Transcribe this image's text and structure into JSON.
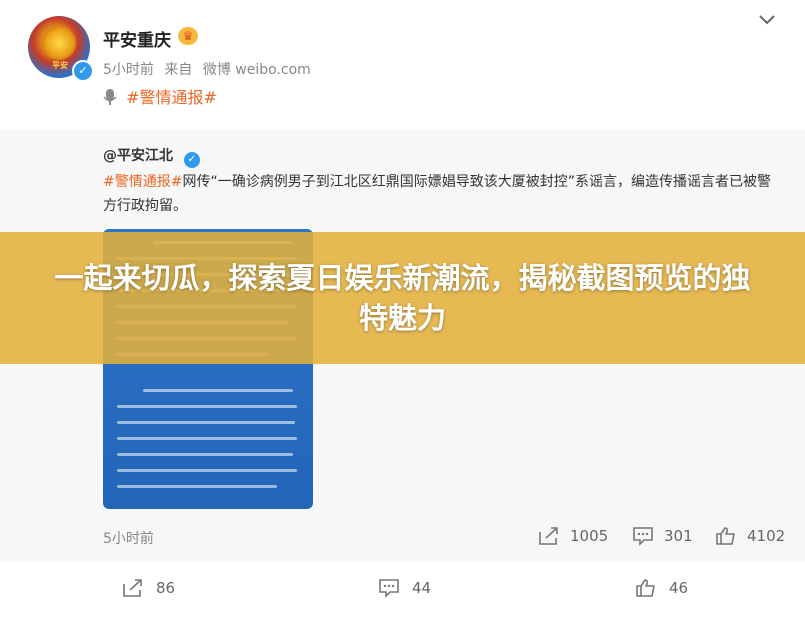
{
  "post": {
    "author": "平安重庆",
    "time": "5小时前",
    "source_prefix": "来自",
    "source": "微博 weibo.com",
    "text": "#警情通报#"
  },
  "repost": {
    "author": "@平安江北",
    "body_tag": "#警情通报#",
    "body_text": "网传“一确诊病例男子到江北区红鼎国际嫖娼导致该大厦被封控”系谣言，编造传播谣言者已被警方行政拘留。",
    "time": "5小时前",
    "stats": {
      "reposts": "1005",
      "comments": "301",
      "likes": "4102"
    }
  },
  "actions": {
    "reposts": "86",
    "comments": "44",
    "likes": "46"
  },
  "banner": {
    "title": "一起来切瓜，探索夏日娱乐新潮流，揭秘截图预览的独特魅力"
  },
  "colors": {
    "accent": "#e86722",
    "verified": "#2f9bea",
    "banner": "#e4b03c"
  }
}
